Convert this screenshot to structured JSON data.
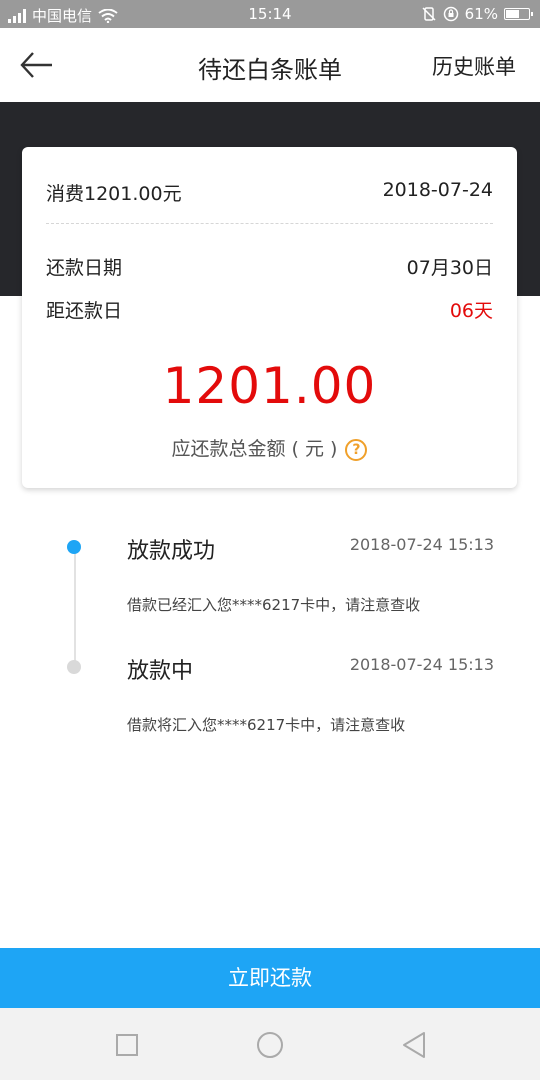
{
  "status_bar": {
    "carrier": "中国电信",
    "time": "15:14",
    "battery": "61%",
    "battery_level": 0.61,
    "icons": [
      "signal-icon",
      "wifi-icon",
      "vibrate-icon",
      "rotation-lock-icon",
      "battery-icon"
    ]
  },
  "header": {
    "title": "待还白条账单",
    "history_label": "历史账单",
    "back_icon": "arrow-left-icon"
  },
  "bill_card": {
    "consume_label": "消费1201.00元",
    "consume_date": "2018-07-24",
    "repay_date_label": "还款日期",
    "repay_date_value": "07月30日",
    "days_left_label": "距还款日",
    "days_left_value": "06天",
    "total_amount": "1201.00",
    "total_label": "应还款总金额 ( 元 )",
    "help_icon": "question-circle-icon",
    "accent_color": "#e30b0b",
    "help_color": "#f0a02a"
  },
  "timeline": [
    {
      "title": "放款成功",
      "time": "2018-07-24 15:13",
      "desc": "借款已经汇入您****6217卡中，请注意查收",
      "active": true
    },
    {
      "title": "放款中",
      "time": "2018-07-24 15:13",
      "desc": "借款将汇入您****6217卡中，请注意查收",
      "active": false
    }
  ],
  "actions": {
    "repay_label": "立即还款",
    "repay_color": "#1ea5f5"
  },
  "nav_bar": {
    "icons": [
      "square-icon",
      "circle-icon",
      "triangle-back-icon"
    ]
  }
}
